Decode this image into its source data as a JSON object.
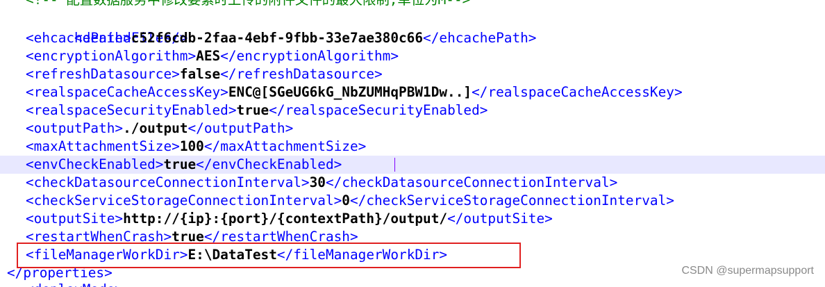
{
  "editor": {
    "comment_line": "<!-- 配置数据服务中修改要素时上传的附件文件的最大限制,单位为M-->",
    "lines": [
      {
        "open": "<deniedFiles/>",
        "value": "",
        "close": ""
      },
      {
        "open": "<ehcachePath>",
        "value": "c52f6cdb-2faa-4ebf-9fbb-33e7ae380c66",
        "close": "</ehcachePath>"
      },
      {
        "open": "<encryptionAlgorithm>",
        "value": "AES",
        "close": "</encryptionAlgorithm>"
      },
      {
        "open": "<refreshDatasource>",
        "value": "false",
        "close": "</refreshDatasource>"
      },
      {
        "open": "<realspaceCacheAccessKey>",
        "value": "ENC@[SGeUG6kG_NbZUMHqPBW1Dw..]",
        "close": "</realspaceCacheAccessKey>"
      },
      {
        "open": "<realspaceSecurityEnabled>",
        "value": "true",
        "close": "</realspaceSecurityEnabled>"
      },
      {
        "open": "<outputPath>",
        "value": "./output",
        "close": "</outputPath>"
      },
      {
        "open": "<maxAttachmentSize>",
        "value": "100",
        "close": "</maxAttachmentSize>"
      },
      {
        "open": "<envCheckEnabled>",
        "value": "true",
        "close": "</envCheckEnabled>"
      },
      {
        "open": "<checkDatasourceConnectionInterval>",
        "value": "30",
        "close": "</checkDatasourceConnectionInterval>"
      },
      {
        "open": "<checkServiceStorageConnectionInterval>",
        "value": "0",
        "close": "</checkServiceStorageConnectionInterval>"
      },
      {
        "open": "<outputSite>",
        "value": "http://{ip}:{port}/{contextPath}/output/",
        "close": "</outputSite>"
      },
      {
        "open": "<restartWhenCrash>",
        "value": "true",
        "close": "</restartWhenCrash>"
      },
      {
        "open": "<fileManagerWorkDir>",
        "value": "E:\\DataTest",
        "close": "</fileManagerWorkDir>"
      }
    ],
    "properties_close": "</properties>",
    "partial_next_line": "<deployMode>"
  },
  "watermark": "CSDN @supermapsupport",
  "colors": {
    "tag": "#0000ff",
    "comment": "#008000",
    "value": "#000000",
    "current_line": "#e8e8ff",
    "highlight_box": "#e02020"
  }
}
